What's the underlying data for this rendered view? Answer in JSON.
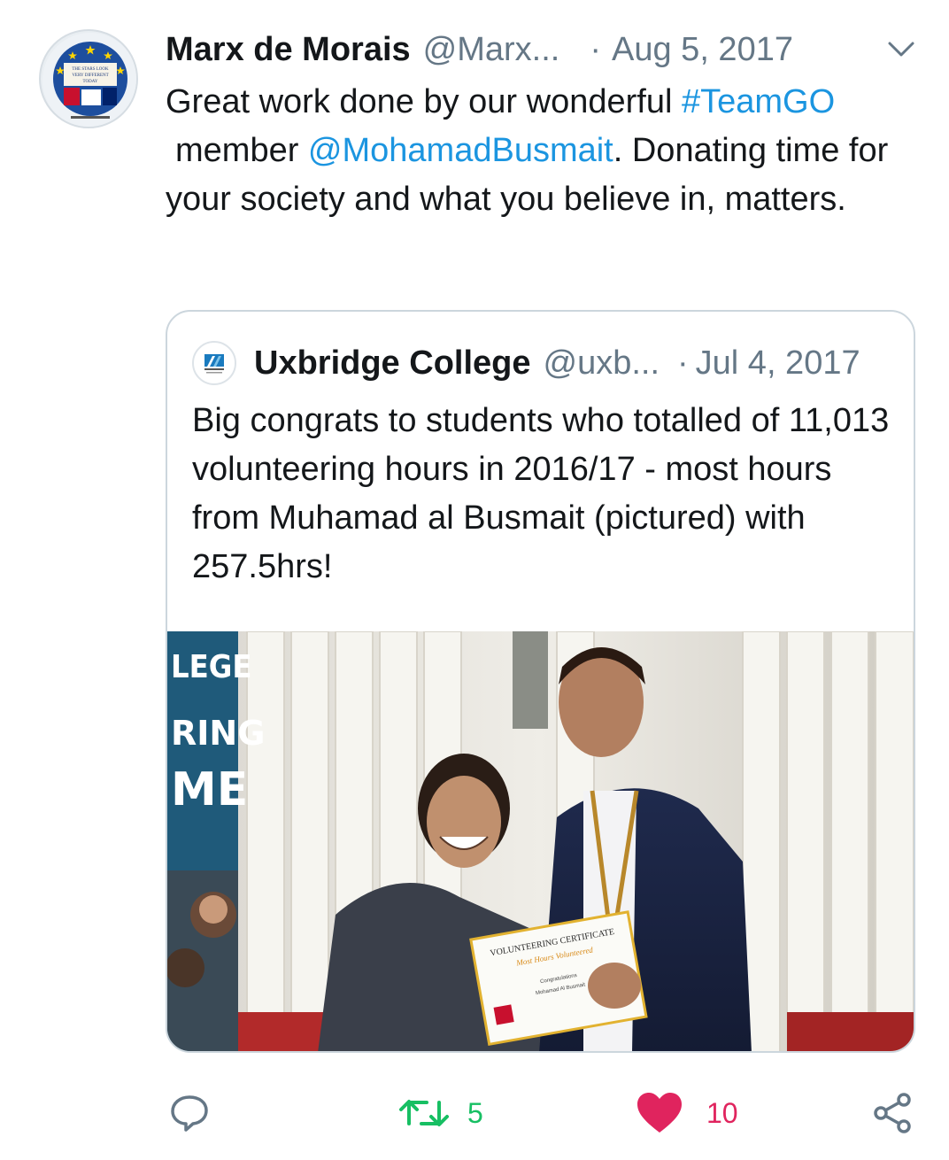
{
  "tweet": {
    "author": {
      "display_name": "Marx de Morais",
      "handle": "@Marx...",
      "avatar_text": [
        "THE STARS LOOK",
        "VERY DIFFERENT",
        "TODAY"
      ]
    },
    "separator": "·",
    "date": "Aug 5, 2017",
    "text": {
      "part1": "Great work done by our wonderful ",
      "hashtag": "#TeamGO",
      "part2": "member ",
      "mention": "@MohamadBusmait",
      "part3": ". Donating time for your society and what you believe in, matters."
    }
  },
  "quoted_tweet": {
    "display_name": "Uxbridge College",
    "handle": "@uxb...",
    "separator": "·",
    "date": "Jul 4, 2017",
    "text": "Big congrats to students who totalled of 11,013 volunteering hours in 2016/17 - most hours from Muhamad al Busmait (pictured) with 257.5hrs!",
    "photo": {
      "banner_text": [
        "LEGE",
        "RING",
        "ME"
      ],
      "certificate_title": "VOLUNTEERING CERTIFICATE",
      "certificate_subtitle": "Most Hours Volunteered",
      "certificate_body": "Congratulations",
      "certificate_name": "Mohamad Al Busmait"
    }
  },
  "actions": {
    "retweet_count": "5",
    "like_count": "10"
  },
  "colors": {
    "link": "#1b95e0",
    "retweet": "#17bf63",
    "like": "#e0245e",
    "secondary_text": "#657786"
  }
}
